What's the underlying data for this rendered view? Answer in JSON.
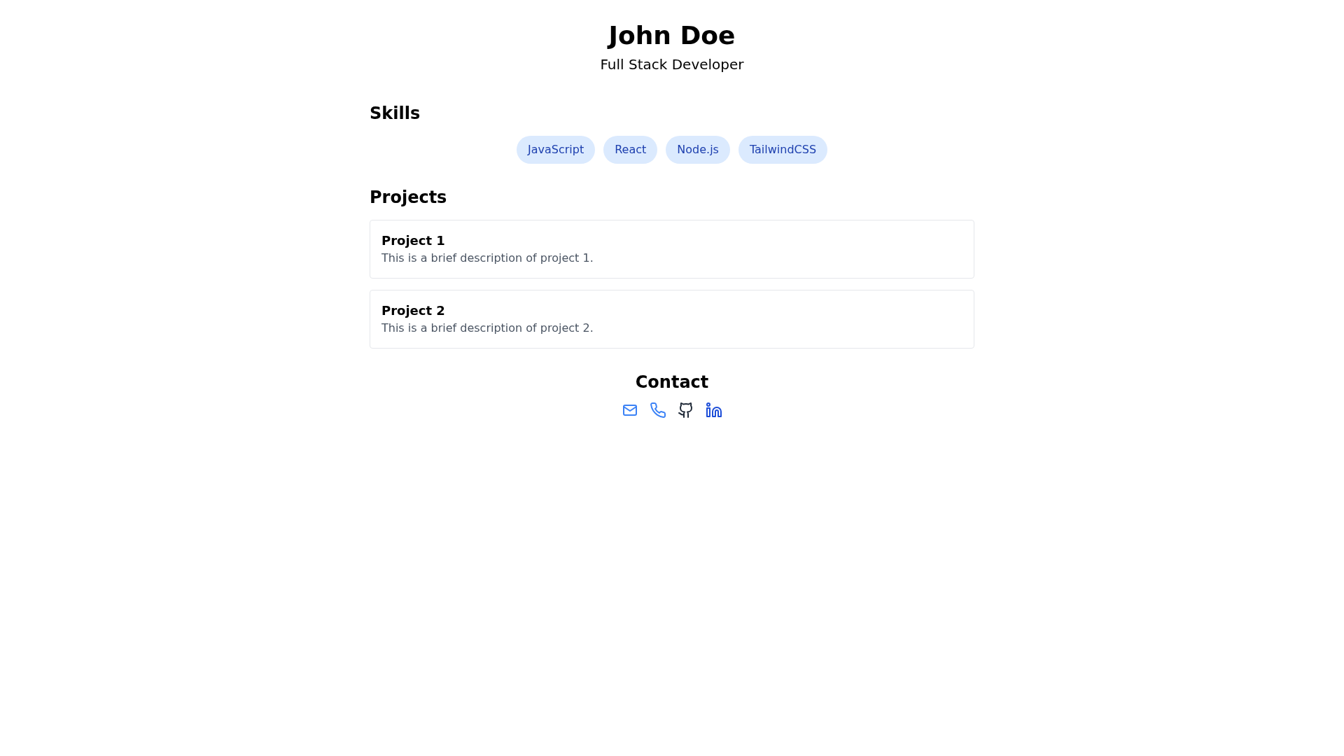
{
  "header": {
    "name": "John Doe",
    "title": "Full Stack Developer"
  },
  "skills": {
    "heading": "Skills",
    "tags": [
      "JavaScript",
      "React",
      "Node.js",
      "TailwindCSS"
    ]
  },
  "projects": {
    "heading": "Projects",
    "items": [
      {
        "title": "Project 1",
        "description": "This is a brief description of project 1."
      },
      {
        "title": "Project 2",
        "description": "This is a brief description of project 2."
      }
    ]
  },
  "contact": {
    "heading": "Contact",
    "links": [
      {
        "kind": "email"
      },
      {
        "kind": "phone"
      },
      {
        "kind": "github"
      },
      {
        "kind": "linkedin"
      }
    ]
  }
}
